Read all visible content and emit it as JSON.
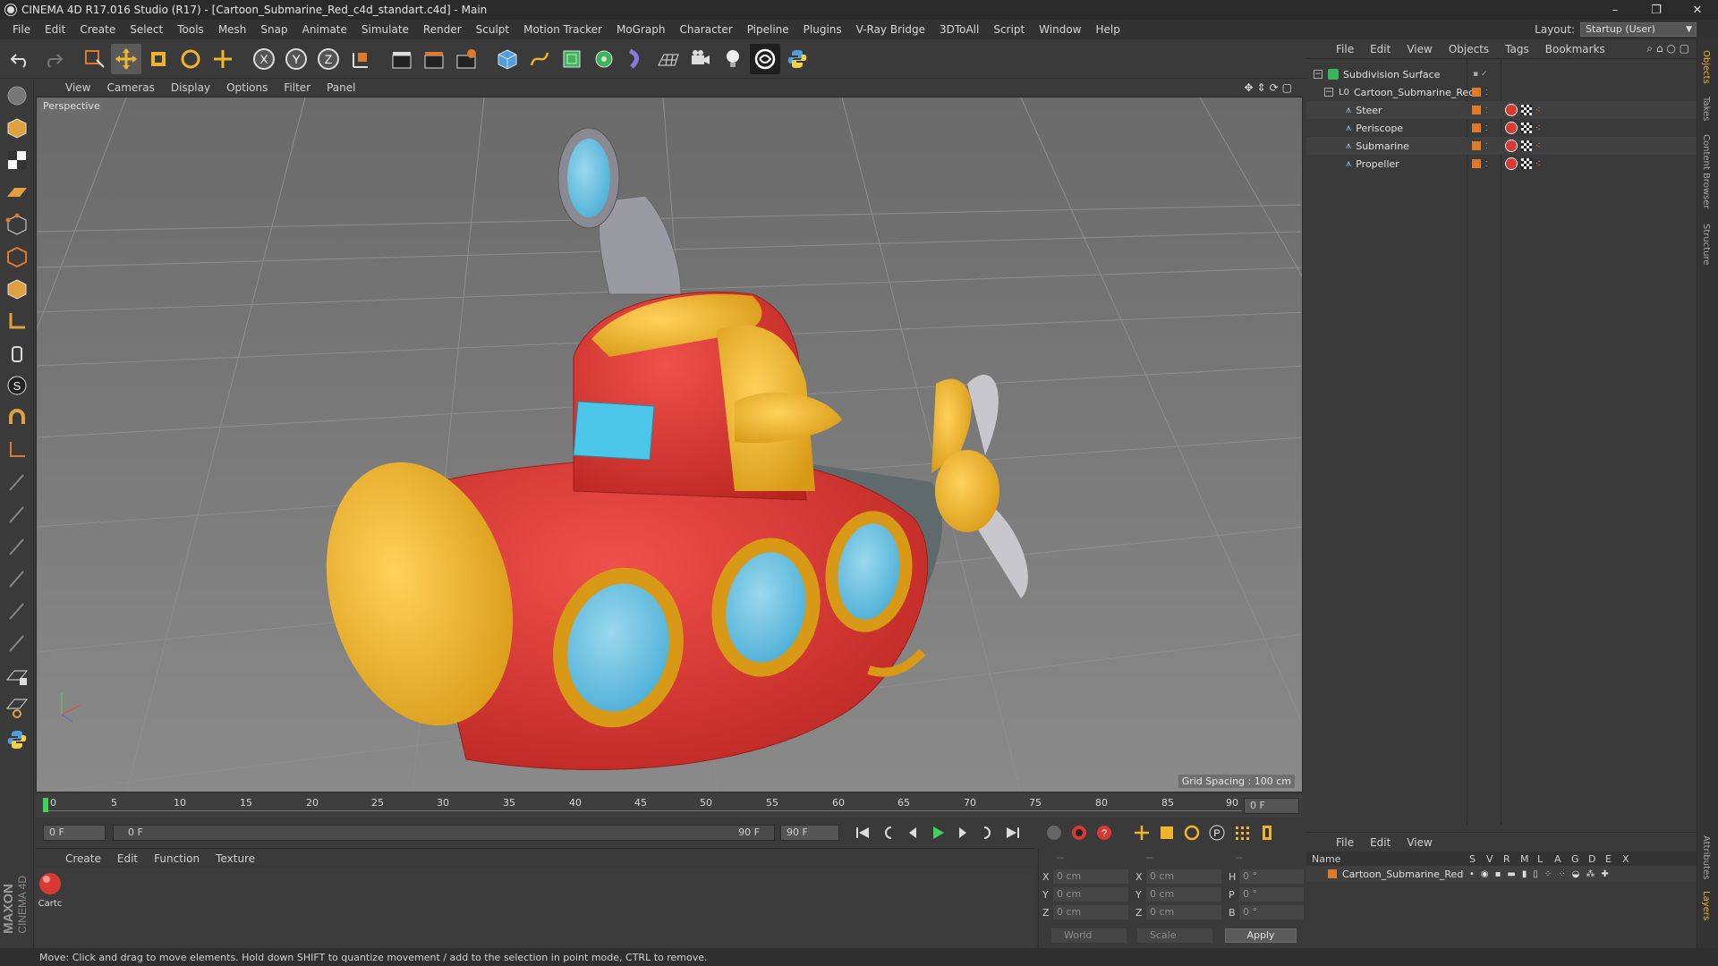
{
  "window": {
    "title": "CINEMA 4D R17.016 Studio (R17) - [Cartoon_Submarine_Red_c4d_standart.c4d] - Main",
    "controls": [
      "–",
      "❐",
      "✕"
    ]
  },
  "menubar": {
    "items": [
      "File",
      "Edit",
      "Create",
      "Select",
      "Tools",
      "Mesh",
      "Snap",
      "Animate",
      "Simulate",
      "Render",
      "Sculpt",
      "Motion Tracker",
      "MoGraph",
      "Character",
      "Pipeline",
      "Plugins",
      "V-Ray Bridge",
      "3DToAll",
      "Script",
      "Window",
      "Help"
    ],
    "layout_label": "Layout:",
    "layout_value": "Startup (User)"
  },
  "viewport": {
    "menu": [
      "View",
      "Cameras",
      "Display",
      "Options",
      "Filter",
      "Panel"
    ],
    "camera_label": "Perspective",
    "grid_spacing": "Grid Spacing : 100 cm"
  },
  "timeline": {
    "ticks": [
      "0",
      "5",
      "10",
      "15",
      "20",
      "25",
      "30",
      "35",
      "40",
      "45",
      "50",
      "55",
      "60",
      "65",
      "70",
      "75",
      "80",
      "85",
      "90"
    ],
    "end_field": "0 F"
  },
  "playback": {
    "current_frame": "0 F",
    "range_start": "0 F",
    "range_end": "90 F",
    "max_frame": "90 F"
  },
  "material_manager": {
    "menu": [
      "Create",
      "Edit",
      "Function",
      "Texture"
    ],
    "materials": [
      {
        "label": "Cartc"
      }
    ]
  },
  "coordinates": {
    "header": [
      "--",
      "--",
      "--"
    ],
    "rows": [
      {
        "a": "X",
        "av": "0 cm",
        "b": "X",
        "bv": "0 cm",
        "c": "H",
        "cv": "0 °"
      },
      {
        "a": "Y",
        "av": "0 cm",
        "b": "Y",
        "bv": "0 cm",
        "c": "P",
        "cv": "0 °"
      },
      {
        "a": "Z",
        "av": "0 cm",
        "b": "Z",
        "bv": "0 cm",
        "c": "B",
        "cv": "0 °"
      }
    ],
    "world": "World",
    "scale": "Scale",
    "apply": "Apply"
  },
  "object_manager": {
    "menu": [
      "File",
      "Edit",
      "View",
      "Objects",
      "Tags",
      "Bookmarks"
    ],
    "objects": [
      {
        "name": "Subdivision Surface",
        "indent": 0
      },
      {
        "name": "Cartoon_Submarine_Red",
        "indent": 1
      },
      {
        "name": "Steer",
        "indent": 2
      },
      {
        "name": "Periscope",
        "indent": 2
      },
      {
        "name": "Submarine",
        "indent": 2
      },
      {
        "name": "Propeller",
        "indent": 2
      }
    ]
  },
  "layer_manager": {
    "menu": [
      "File",
      "Edit",
      "View"
    ],
    "columns": [
      "Name",
      "S",
      "V",
      "R",
      "M",
      "L",
      "A",
      "G",
      "D",
      "E",
      "X"
    ],
    "rows": [
      {
        "name": "Cartoon_Submarine_Red"
      }
    ]
  },
  "right_tabs": [
    "Objects",
    "Takes",
    "Content Browser",
    "Structure",
    "Attributes",
    "Layers"
  ],
  "brand": {
    "maxon": "MAXON",
    "product": "CINEMA 4D"
  },
  "status": "Move: Click and drag to move elements. Hold down SHIFT to quantize movement / add to the selection in point mode, CTRL to remove.",
  "colors": {
    "accent": "#4f9fe0",
    "layer_orange": "#e07a2a",
    "sub_red": "#e03a32",
    "sub_yellow": "#f0b42a",
    "glass": "#63c2e4"
  }
}
